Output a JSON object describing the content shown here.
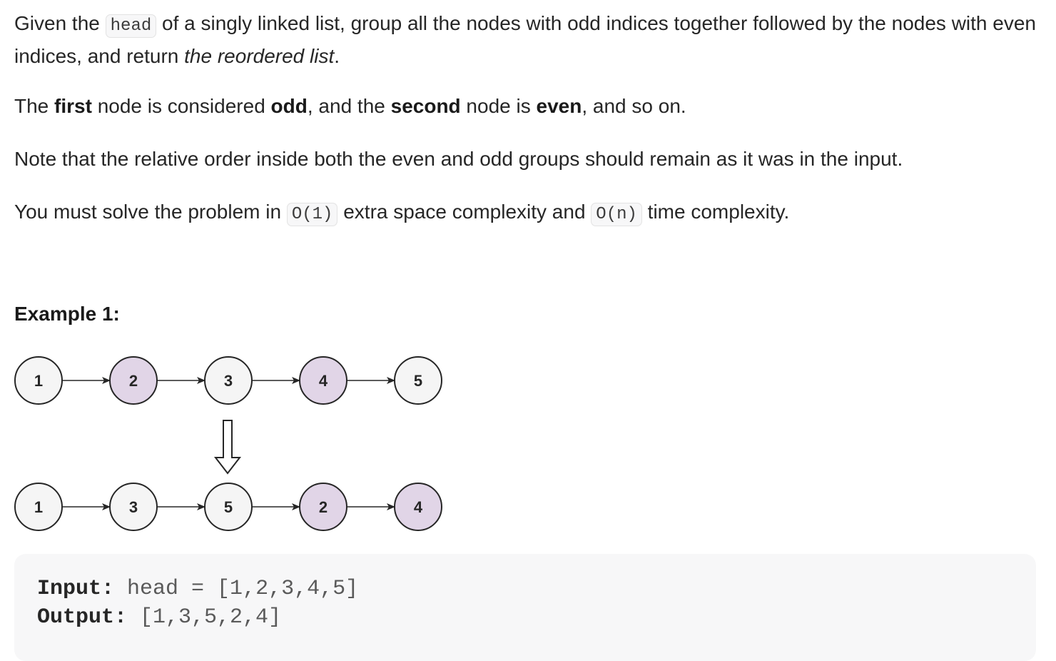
{
  "description": {
    "p1": {
      "t1": "Given the ",
      "code": "head",
      "t2": " of a singly linked list, group all the nodes with odd indices together followed by the nodes with even indices, and return ",
      "em": "the reordered list",
      "t3": "."
    },
    "p2": {
      "t1": "The ",
      "b1": "first",
      "t2": " node is considered ",
      "b2": "odd",
      "t3": ", and the ",
      "b3": "second",
      "t4": " node is ",
      "b4": "even",
      "t5": ", and so on."
    },
    "p3": "Note that the relative order inside both the even and odd groups should remain as it was in the input.",
    "p4": {
      "t1": "You must solve the problem in ",
      "code1": "O(1)",
      "t2": " extra space complexity and ",
      "code2": "O(n)",
      "t3": " time complexity."
    }
  },
  "example": {
    "title": "Example 1:",
    "diagram": {
      "top_row": [
        {
          "value": "1",
          "group": "odd"
        },
        {
          "value": "2",
          "group": "even"
        },
        {
          "value": "3",
          "group": "odd"
        },
        {
          "value": "4",
          "group": "even"
        },
        {
          "value": "5",
          "group": "odd"
        }
      ],
      "bottom_row": [
        {
          "value": "1",
          "group": "odd"
        },
        {
          "value": "3",
          "group": "odd"
        },
        {
          "value": "5",
          "group": "odd"
        },
        {
          "value": "2",
          "group": "even"
        },
        {
          "value": "4",
          "group": "even"
        }
      ],
      "colors": {
        "odd_fill": "#f5f5f5",
        "even_fill": "#e1d5e7",
        "stroke": "#262626"
      }
    },
    "input_label": "Input:",
    "input_value": " head = [1,2,3,4,5]",
    "output_label": "Output:",
    "output_value": " [1,3,5,2,4]"
  }
}
